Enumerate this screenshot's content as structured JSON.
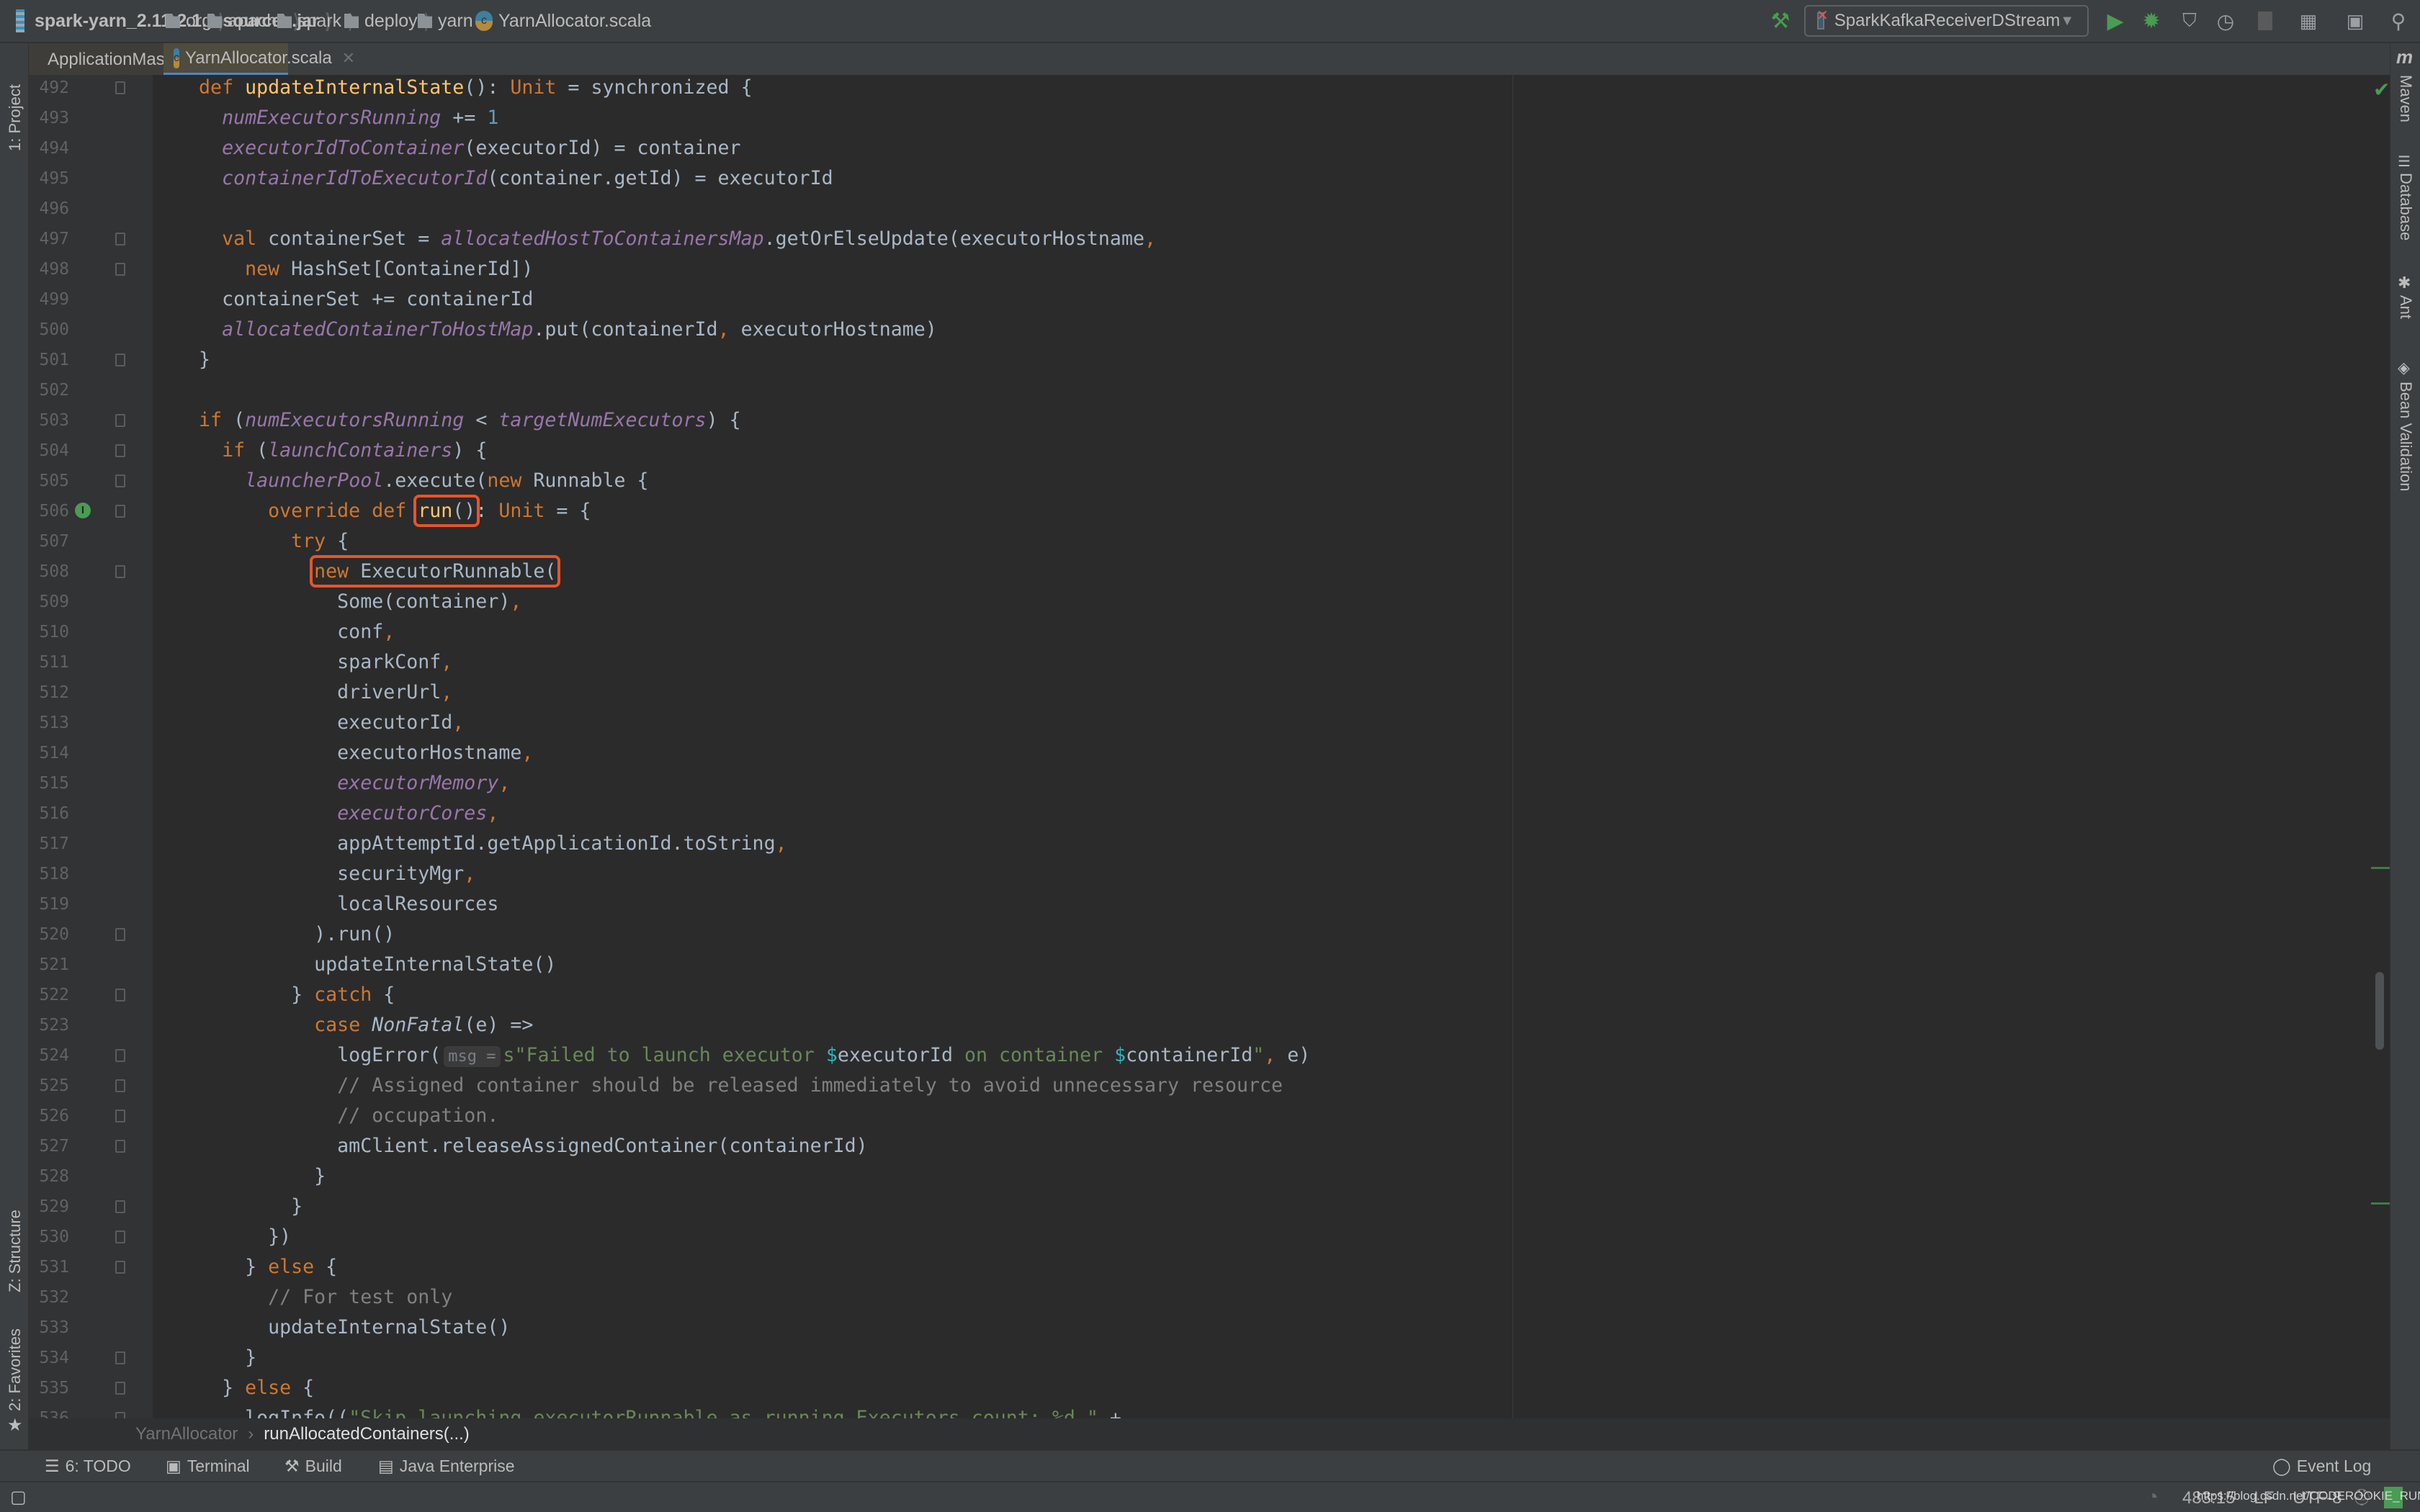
{
  "navbar": {
    "crumbs": [
      {
        "label": "spark-yarn_2.11-2.1.1-sources.jar",
        "icon": "jar-icon"
      },
      {
        "label": "org",
        "icon": "folder-icon"
      },
      {
        "label": "apache",
        "icon": "folder-icon"
      },
      {
        "label": "spark",
        "icon": "folder-icon"
      },
      {
        "label": "deploy",
        "icon": "folder-icon"
      },
      {
        "label": "yarn",
        "icon": "folder-icon"
      },
      {
        "label": "YarnAllocator.scala",
        "icon": "scala-file-icon"
      }
    ],
    "run_config": "SparkKafkaReceiverDStream",
    "toolbar_icons": [
      "build-hammer-icon",
      "run-icon",
      "debug-icon",
      "run-with-coverage-icon",
      "profile-icon",
      "stop-icon",
      "project-structure-icon",
      "terminal-icon",
      "search-icon"
    ]
  },
  "tabs": [
    {
      "label": "ApplicationMaster.scala",
      "active": false
    },
    {
      "label": "YarnAllocator.scala",
      "active": true
    }
  ],
  "left_strip": {
    "project": "1: Project",
    "structure": "Z: Structure",
    "favorites": "2: Favorites"
  },
  "right_strip": {
    "maven": "Maven",
    "database": "Database",
    "ant": "Ant",
    "bean_validation": "Bean Validation"
  },
  "editor": {
    "first_line": 492,
    "lines": [
      {
        "n": 492,
        "fold": true,
        "tokens": [
          [
            "t",
            "    "
          ],
          [
            "k",
            "def "
          ],
          [
            "fn",
            "updateInternalState"
          ],
          [
            "t",
            "(): "
          ],
          [
            "k",
            "Unit"
          ],
          [
            "t",
            " = synchronized {"
          ]
        ]
      },
      {
        "n": 493,
        "tokens": [
          [
            "t",
            "      "
          ],
          [
            "f",
            "numExecutorsRunning"
          ],
          [
            "t",
            " += "
          ],
          [
            "n",
            "1"
          ]
        ]
      },
      {
        "n": 494,
        "tokens": [
          [
            "t",
            "      "
          ],
          [
            "f",
            "executorIdToContainer"
          ],
          [
            "t",
            "(executorId) = container"
          ]
        ]
      },
      {
        "n": 495,
        "tokens": [
          [
            "t",
            "      "
          ],
          [
            "f",
            "containerIdToExecutorId"
          ],
          [
            "t",
            "(container.getId) = executorId"
          ]
        ]
      },
      {
        "n": 496,
        "tokens": []
      },
      {
        "n": 497,
        "fold": true,
        "tokens": [
          [
            "t",
            "      "
          ],
          [
            "k",
            "val "
          ],
          [
            "t",
            "containerSet = "
          ],
          [
            "f",
            "allocatedHostToContainersMap"
          ],
          [
            "t",
            ".getOrElseUpdate(executorHostname"
          ],
          [
            "o",
            ","
          ]
        ]
      },
      {
        "n": 498,
        "fold": true,
        "tokens": [
          [
            "t",
            "        "
          ],
          [
            "k",
            "new "
          ],
          [
            "t",
            "HashSet[ContainerId])"
          ]
        ]
      },
      {
        "n": 499,
        "tokens": [
          [
            "t",
            "      containerSet += containerId"
          ]
        ]
      },
      {
        "n": 500,
        "tokens": [
          [
            "t",
            "      "
          ],
          [
            "f",
            "allocatedContainerToHostMap"
          ],
          [
            "t",
            ".put(containerId"
          ],
          [
            "o",
            ", "
          ],
          [
            "t",
            "executorHostname)"
          ]
        ]
      },
      {
        "n": 501,
        "fold": true,
        "tokens": [
          [
            "t",
            "    }"
          ]
        ]
      },
      {
        "n": 502,
        "tokens": []
      },
      {
        "n": 503,
        "fold": true,
        "tokens": [
          [
            "t",
            "    "
          ],
          [
            "k",
            "if "
          ],
          [
            "t",
            "("
          ],
          [
            "f",
            "numExecutorsRunning"
          ],
          [
            "t",
            " < "
          ],
          [
            "f",
            "targetNumExecutors"
          ],
          [
            "t",
            ") {"
          ]
        ]
      },
      {
        "n": 504,
        "fold": true,
        "tokens": [
          [
            "t",
            "      "
          ],
          [
            "k",
            "if "
          ],
          [
            "t",
            "("
          ],
          [
            "f",
            "launchContainers"
          ],
          [
            "t",
            ") {"
          ]
        ]
      },
      {
        "n": 505,
        "fold": true,
        "tokens": [
          [
            "t",
            "        "
          ],
          [
            "f",
            "launcherPool"
          ],
          [
            "t",
            ".execute("
          ],
          [
            "k",
            "new "
          ],
          [
            "t",
            "Runnable {"
          ]
        ]
      },
      {
        "n": 506,
        "fold": true,
        "implements": true,
        "tokens": [
          [
            "t",
            "          "
          ],
          [
            "k",
            "override def "
          ],
          [
            "box",
            [
              [
                "fn",
                "run"
              ],
              [
                "t",
                "()"
              ]
            ]
          ],
          [
            "t",
            ": "
          ],
          [
            "k",
            "Unit"
          ],
          [
            "t",
            " = {"
          ]
        ]
      },
      {
        "n": 507,
        "tokens": [
          [
            "t",
            "            "
          ],
          [
            "k",
            "try "
          ],
          [
            "t",
            "{"
          ]
        ]
      },
      {
        "n": 508,
        "fold": true,
        "tokens": [
          [
            "t",
            "              "
          ],
          [
            "box",
            [
              [
                "k",
                "new "
              ],
              [
                "t",
                "ExecutorRunnable("
              ]
            ]
          ]
        ]
      },
      {
        "n": 509,
        "tokens": [
          [
            "t",
            "                Some(container)"
          ],
          [
            "o",
            ","
          ]
        ]
      },
      {
        "n": 510,
        "tokens": [
          [
            "t",
            "                conf"
          ],
          [
            "o",
            ","
          ]
        ]
      },
      {
        "n": 511,
        "tokens": [
          [
            "t",
            "                sparkConf"
          ],
          [
            "o",
            ","
          ]
        ]
      },
      {
        "n": 512,
        "tokens": [
          [
            "t",
            "                driverUrl"
          ],
          [
            "o",
            ","
          ]
        ]
      },
      {
        "n": 513,
        "tokens": [
          [
            "t",
            "                executorId"
          ],
          [
            "o",
            ","
          ]
        ]
      },
      {
        "n": 514,
        "tokens": [
          [
            "t",
            "                executorHostname"
          ],
          [
            "o",
            ","
          ]
        ]
      },
      {
        "n": 515,
        "tokens": [
          [
            "t",
            "                "
          ],
          [
            "f",
            "executorMemory"
          ],
          [
            "o",
            ","
          ]
        ]
      },
      {
        "n": 516,
        "tokens": [
          [
            "t",
            "                "
          ],
          [
            "f",
            "executorCores"
          ],
          [
            "o",
            ","
          ]
        ]
      },
      {
        "n": 517,
        "tokens": [
          [
            "t",
            "                appAttemptId.getApplicationId.toString"
          ],
          [
            "o",
            ","
          ]
        ]
      },
      {
        "n": 518,
        "tokens": [
          [
            "t",
            "                securityMgr"
          ],
          [
            "o",
            ","
          ]
        ]
      },
      {
        "n": 519,
        "tokens": [
          [
            "t",
            "                localResources"
          ]
        ]
      },
      {
        "n": 520,
        "fold": true,
        "tokens": [
          [
            "t",
            "              ).run()"
          ]
        ]
      },
      {
        "n": 521,
        "tokens": [
          [
            "t",
            "              updateInternalState()"
          ]
        ]
      },
      {
        "n": 522,
        "fold": true,
        "tokens": [
          [
            "t",
            "            } "
          ],
          [
            "k",
            "catch "
          ],
          [
            "t",
            "{"
          ]
        ]
      },
      {
        "n": 523,
        "tokens": [
          [
            "t",
            "              "
          ],
          [
            "k",
            "case "
          ],
          [
            "i",
            "NonFatal"
          ],
          [
            "t",
            "(e) =>"
          ]
        ]
      },
      {
        "n": 524,
        "fold": true,
        "tokens": [
          [
            "t",
            "                logError("
          ],
          [
            "h",
            "msg ="
          ],
          [
            "s",
            "s\"Failed to launch executor "
          ],
          [
            "d",
            "$"
          ],
          [
            "t",
            "executorId"
          ],
          [
            "s",
            " on container "
          ],
          [
            "d",
            "$"
          ],
          [
            "t",
            "containerId"
          ],
          [
            "s",
            "\""
          ],
          [
            "o",
            ","
          ],
          [
            "t",
            " e)"
          ]
        ]
      },
      {
        "n": 525,
        "fold": true,
        "tokens": [
          [
            "t",
            "                "
          ],
          [
            "c",
            "// Assigned container should be released immediately to avoid unnecessary resource"
          ]
        ]
      },
      {
        "n": 526,
        "fold": true,
        "tokens": [
          [
            "t",
            "                "
          ],
          [
            "c",
            "// occupation."
          ]
        ]
      },
      {
        "n": 527,
        "fold": true,
        "tokens": [
          [
            "t",
            "                amClient.releaseAssignedContainer(containerId)"
          ]
        ]
      },
      {
        "n": 528,
        "tokens": [
          [
            "t",
            "              }"
          ]
        ]
      },
      {
        "n": 529,
        "fold": true,
        "tokens": [
          [
            "t",
            "            }"
          ]
        ]
      },
      {
        "n": 530,
        "fold": true,
        "tokens": [
          [
            "t",
            "          })"
          ]
        ]
      },
      {
        "n": 531,
        "fold": true,
        "tokens": [
          [
            "t",
            "        } "
          ],
          [
            "k",
            "else "
          ],
          [
            "t",
            "{"
          ]
        ]
      },
      {
        "n": 532,
        "tokens": [
          [
            "t",
            "          "
          ],
          [
            "c",
            "// For test only"
          ]
        ]
      },
      {
        "n": 533,
        "tokens": [
          [
            "t",
            "          updateInternalState()"
          ]
        ]
      },
      {
        "n": 534,
        "fold": true,
        "tokens": [
          [
            "t",
            "        }"
          ]
        ]
      },
      {
        "n": 535,
        "fold": true,
        "tokens": [
          [
            "t",
            "      } "
          ],
          [
            "k",
            "else "
          ],
          [
            "t",
            "{"
          ]
        ]
      },
      {
        "n": 536,
        "fold": true,
        "tokens": [
          [
            "t",
            "        logInfo(("
          ],
          [
            "s",
            "\"Skip launching executorRunnable as running Executors count: %d \""
          ],
          [
            "t",
            " +"
          ]
        ]
      }
    ]
  },
  "breadcrumb": {
    "class": "YarnAllocator",
    "method": "runAllocatedContainers(...)"
  },
  "tool_windows": {
    "todo": "6: TODO",
    "terminal": "Terminal",
    "build": "Build",
    "java_enterprise": "Java Enterprise",
    "event_log": "Event Log"
  },
  "status": {
    "position": "483:15",
    "line_sep": "LF",
    "encoding": "UTF-8"
  },
  "watermark": "https://blog.csdn.net/CODEROOKIE_RUN",
  "colors": {
    "keyword": "#cc7832",
    "function": "#ffc66d",
    "field": "#9876aa",
    "string": "#6a8759",
    "comment": "#808080",
    "highlight_box": "#e8542a",
    "accent": "#4a88c7"
  }
}
